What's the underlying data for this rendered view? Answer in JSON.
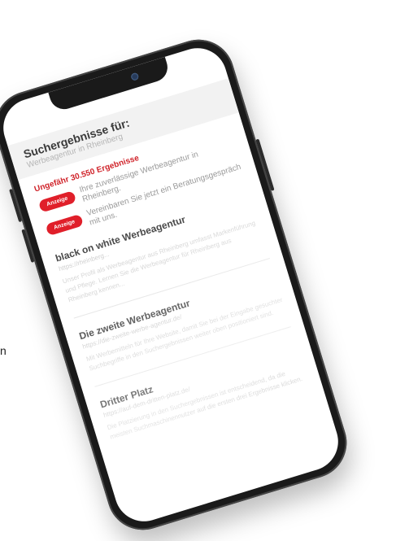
{
  "stray_text": "n",
  "search": {
    "title": "Suchergebnisse für:",
    "query": "Werbeagentur in Rheinberg",
    "result_count": "Ungefähr 30.550 Ergebnisse"
  },
  "ads": [
    {
      "badge": "Anzeige",
      "text": "Ihre zuverlässige Werbeagentur in Rheinberg."
    },
    {
      "badge": "Anzeige",
      "text": "Vereinbaren Sie jetzt ein Beratungsgespräch mit uns."
    }
  ],
  "results": [
    {
      "title": "black on white Werbeagentur",
      "url": "https://rheinberg...",
      "snippet": "Unser Profil als Werbeagentur aus Rheinberg umfasst Markenführung und Pflege. Lernen Sie die Werbeagentur für Rheinberg aus Rheinberg kennen..."
    },
    {
      "title": "Die zweite Werbeagentur",
      "url": "https://die-zweite-werbe-agentur.de/",
      "snippet": "Mit Werbemitteln für Ihre Website, damit Sie bei der Eingabe gesuchter Suchbegriffe in den Suchergebnissen weiter oben positioniert sind."
    },
    {
      "title": "Dritter Platz",
      "url": "https://auf-dem-dritten-platz.de/",
      "snippet": "Die Platzierung in den Suchergebnissen ist entscheidend, da die meisten Suchmaschinennutzer auf die ersten drei Ergebnisse klicken."
    }
  ],
  "colors": {
    "accent": "#e01f2a",
    "count_text": "#d0242b"
  }
}
